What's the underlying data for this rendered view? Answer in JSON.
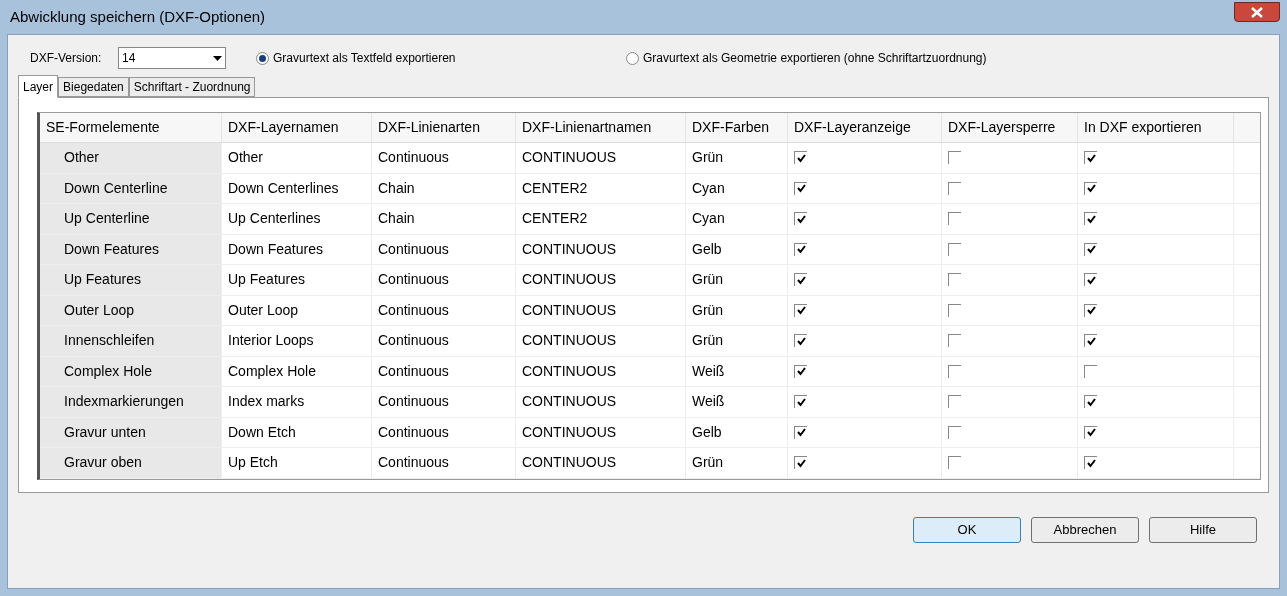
{
  "window": {
    "title": "Abwicklung speichern (DXF-Optionen)"
  },
  "dxf_version": {
    "label": "DXF-Version:",
    "value": "14"
  },
  "engrave_options": [
    {
      "label": "Gravurtext als Textfeld exportieren",
      "selected": true
    },
    {
      "label": "Gravurtext als Geometrie exportieren (ohne Schriftartzuordnung)",
      "selected": false
    }
  ],
  "tabs": [
    {
      "label": "Layer",
      "selected": true
    },
    {
      "label": "Biegedaten",
      "selected": false
    },
    {
      "label": "Schriftart - Zuordnung",
      "selected": false
    }
  ],
  "table": {
    "columns": [
      "SE-Formelemente",
      "DXF-Layernamen",
      "DXF-Linienarten",
      "DXF-Linienartnamen",
      "DXF-Farben",
      "DXF-Layeranzeige",
      "DXF-Layersperre",
      "In DXF exportieren"
    ],
    "rows": [
      {
        "element": "Other",
        "layer": "Other",
        "linetype": "Continuous",
        "linetype_name": "CONTINUOUS",
        "color_name": "Grün",
        "display": true,
        "lock": false,
        "export": true
      },
      {
        "element": "Down Centerline",
        "layer": "Down Centerlines",
        "linetype": "Chain",
        "linetype_name": "CENTER2",
        "color_name": "Cyan",
        "display": true,
        "lock": false,
        "export": true
      },
      {
        "element": "Up Centerline",
        "layer": "Up Centerlines",
        "linetype": "Chain",
        "linetype_name": "CENTER2",
        "color_name": "Cyan",
        "display": true,
        "lock": false,
        "export": true
      },
      {
        "element": "Down Features",
        "layer": "Down Features",
        "linetype": "Continuous",
        "linetype_name": "CONTINUOUS",
        "color_name": "Gelb",
        "display": true,
        "lock": false,
        "export": true
      },
      {
        "element": "Up Features",
        "layer": "Up Features",
        "linetype": "Continuous",
        "linetype_name": "CONTINUOUS",
        "color_name": "Grün",
        "display": true,
        "lock": false,
        "export": true
      },
      {
        "element": "Outer Loop",
        "layer": "Outer Loop",
        "linetype": "Continuous",
        "linetype_name": "CONTINUOUS",
        "color_name": "Grün",
        "display": true,
        "lock": false,
        "export": true
      },
      {
        "element": "Innenschleifen",
        "layer": "Interior Loops",
        "linetype": "Continuous",
        "linetype_name": "CONTINUOUS",
        "color_name": "Grün",
        "display": true,
        "lock": false,
        "export": true
      },
      {
        "element": "Complex Hole",
        "layer": "Complex Hole",
        "linetype": "Continuous",
        "linetype_name": "CONTINUOUS",
        "color_name": "Weiß",
        "display": true,
        "lock": false,
        "export": false
      },
      {
        "element": "Indexmarkierungen",
        "layer": "Index marks",
        "linetype": "Continuous",
        "linetype_name": "CONTINUOUS",
        "color_name": "Weiß",
        "display": true,
        "lock": false,
        "export": true
      },
      {
        "element": "Gravur unten",
        "layer": "Down Etch",
        "linetype": "Continuous",
        "linetype_name": "CONTINUOUS",
        "color_name": "Gelb",
        "display": true,
        "lock": false,
        "export": true
      },
      {
        "element": "Gravur oben",
        "layer": "Up Etch",
        "linetype": "Continuous",
        "linetype_name": "CONTINUOUS",
        "color_name": "Grün",
        "display": true,
        "lock": false,
        "export": true
      }
    ]
  },
  "buttons": [
    {
      "label": "OK",
      "kind": "default"
    },
    {
      "label": "Abbrechen",
      "kind": "normal"
    },
    {
      "label": "Hilfe",
      "kind": "normal"
    }
  ]
}
